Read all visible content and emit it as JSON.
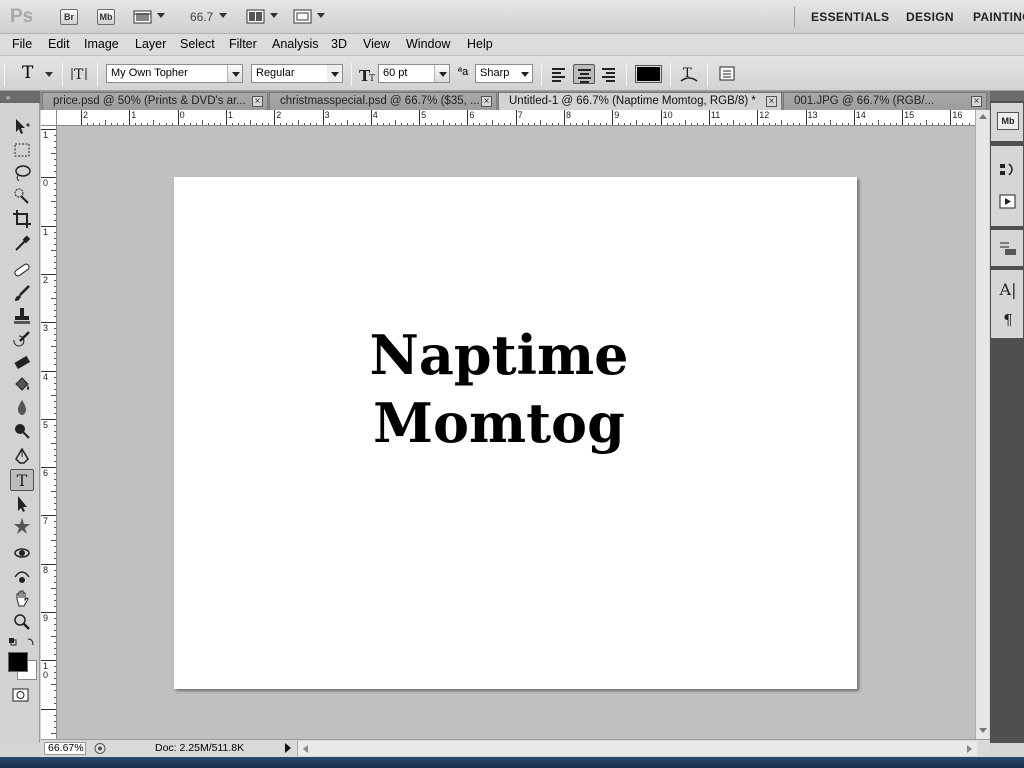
{
  "app": {
    "logo": "Ps",
    "bridge_btn": "Br",
    "minibridge_btn": "Mb",
    "zoom": "66.7",
    "workspaces": [
      "ESSENTIALS",
      "DESIGN",
      "PAINTING"
    ]
  },
  "menu": [
    "File",
    "Edit",
    "Image",
    "Layer",
    "Select",
    "Filter",
    "Analysis",
    "3D",
    "View",
    "Window",
    "Help"
  ],
  "options": {
    "tool_glyph": "T",
    "font_family": "My Own Topher",
    "font_style": "Regular",
    "font_size": "60 pt",
    "aa_label": "ªa",
    "antialias": "Sharp",
    "text_color": "#000000"
  },
  "tabs": [
    {
      "label": "price.psd @ 50% (Prints & DVD's ar...",
      "active": false
    },
    {
      "label": "christmasspecial.psd @ 66.7% ($35, ...",
      "active": false
    },
    {
      "label": "Untitled-1 @ 66.7% (Naptime Momtog, RGB/8) *",
      "active": true
    },
    {
      "label": "001.JPG @ 66.7% (RGB/...",
      "active": false
    }
  ],
  "canvas": {
    "line1": "Naptime",
    "line2": "Momtog"
  },
  "rulers": {
    "h_labels": [
      "2",
      "1",
      "0",
      "1",
      "2",
      "3",
      "4",
      "5",
      "6",
      "7",
      "8",
      "9",
      "10",
      "11",
      "12",
      "13",
      "14",
      "15",
      "16"
    ],
    "v_labels": [
      "1",
      "0",
      "1",
      "2",
      "3",
      "4",
      "5",
      "6",
      "7",
      "8",
      "9",
      "10"
    ]
  },
  "status": {
    "zoom": "66.67%",
    "doc_info": "Doc: 2.25M/511.8K"
  },
  "colors": {
    "foreground": "#000000",
    "background": "#ffffff"
  }
}
